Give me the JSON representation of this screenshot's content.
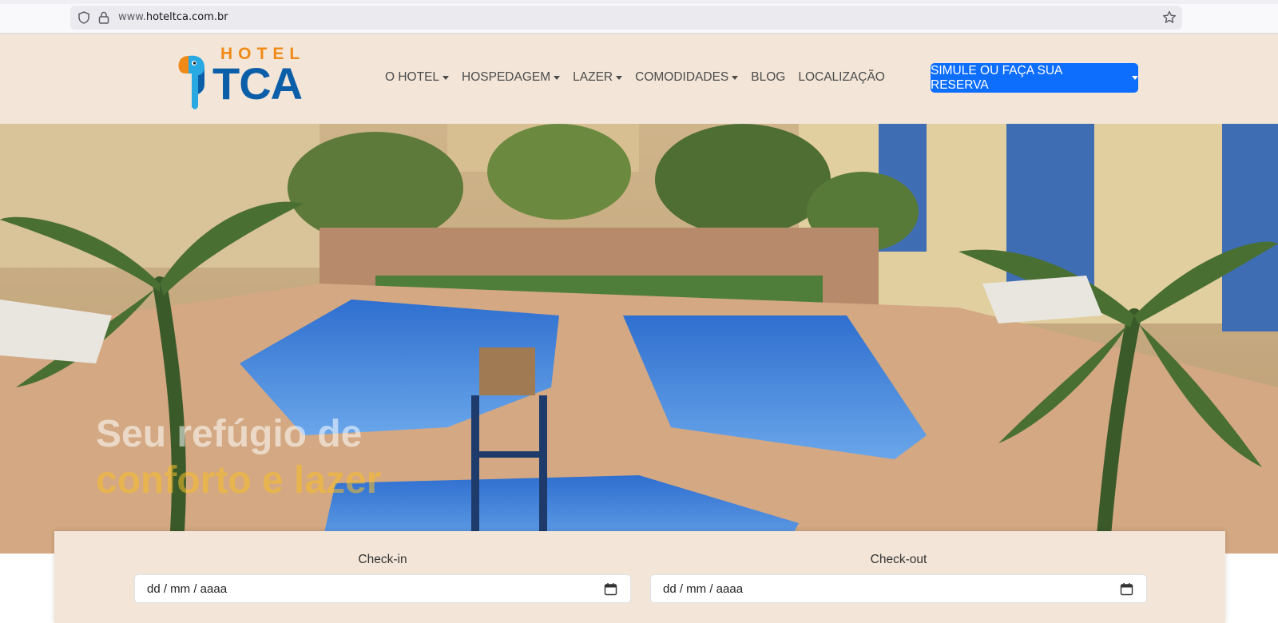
{
  "browser": {
    "url_prefix": "www.",
    "url_domain": "hoteltca.com.br"
  },
  "logo": {
    "word_top": "HOTEL",
    "word_main": "TCA",
    "colors": {
      "orange": "#f08a17",
      "blue": "#0b5ea8"
    }
  },
  "nav": {
    "items": [
      {
        "label": "O HOTEL",
        "dropdown": true
      },
      {
        "label": "HOSPEDAGEM",
        "dropdown": true
      },
      {
        "label": "LAZER",
        "dropdown": true
      },
      {
        "label": "COMODIDADES",
        "dropdown": true
      },
      {
        "label": "BLOG",
        "dropdown": false
      },
      {
        "label": "LOCALIZAÇÃO",
        "dropdown": false
      }
    ]
  },
  "reserve_button": {
    "label": "SIMULE OU FAÇA SUA RESERVA",
    "color": "#0d6efd"
  },
  "hero": {
    "tagline_line1": "Seu refúgio de",
    "tagline_line2": "conforto e lazer"
  },
  "booking": {
    "checkin_label": "Check-in",
    "checkin_value": "dd / mm / aaaa",
    "checkout_label": "Check-out",
    "checkout_value": "dd / mm / aaaa"
  },
  "icons": {
    "shield": "shield-icon",
    "lock": "lock-icon",
    "bookmark": "star-icon",
    "calendar": "calendar-icon"
  },
  "theme": {
    "header_bg": "#f3e6d8"
  }
}
